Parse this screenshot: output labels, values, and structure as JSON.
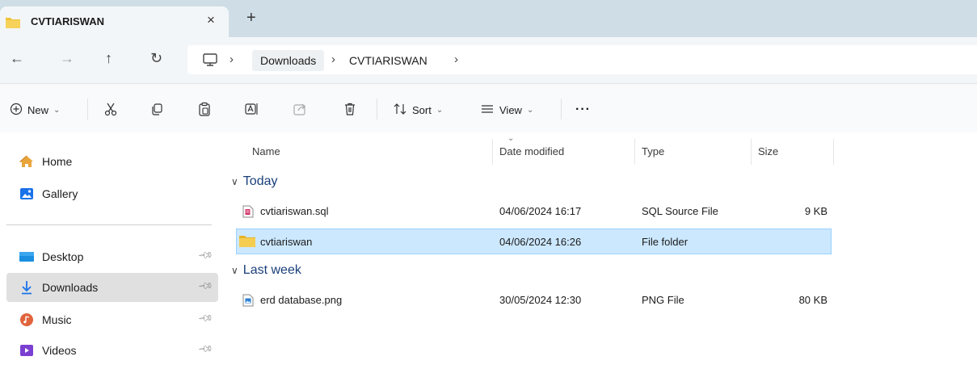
{
  "tab": {
    "title": "CVTIARISWAN",
    "close": "×",
    "new_tab": "+"
  },
  "nav": {
    "back": "←",
    "forward": "→",
    "up": "↑",
    "refresh": "↻",
    "chevron": "›",
    "breadcrumbs": [
      {
        "label": "Downloads"
      },
      {
        "label": "CVTIARISWAN"
      }
    ]
  },
  "toolbar": {
    "new": "New",
    "sort": "Sort",
    "view": "View",
    "more": "···"
  },
  "sidebar": {
    "items": [
      {
        "label": "Home",
        "icon": "home-icon"
      },
      {
        "label": "Gallery",
        "icon": "gallery-icon"
      },
      {
        "label": "Desktop",
        "icon": "desktop-icon",
        "pinned": true
      },
      {
        "label": "Downloads",
        "icon": "download-icon",
        "pinned": true,
        "active": true
      },
      {
        "label": "Music",
        "icon": "music-icon",
        "pinned": true
      },
      {
        "label": "Videos",
        "icon": "videos-icon",
        "pinned": true
      }
    ]
  },
  "columns": {
    "name": "Name",
    "date": "Date modified",
    "type": "Type",
    "size": "Size"
  },
  "groups": [
    {
      "label": "Today",
      "files": [
        {
          "name": "cvtiariswan.sql",
          "date": "04/06/2024 16:17",
          "type": "SQL Source File",
          "size": "9 KB",
          "icon": "sql-file-icon"
        },
        {
          "name": "cvtiariswan",
          "date": "04/06/2024 16:26",
          "type": "File folder",
          "size": "",
          "icon": "folder-icon",
          "selected": true
        }
      ]
    },
    {
      "label": "Last week",
      "files": [
        {
          "name": "erd database.png",
          "date": "30/05/2024 12:30",
          "type": "PNG File",
          "size": "80 KB",
          "icon": "png-file-icon"
        }
      ]
    }
  ],
  "colors": {
    "accent": "#0067c0",
    "selection": "#cce8ff",
    "folder": "#f0c23c",
    "group_text": "#1a3f7a"
  }
}
